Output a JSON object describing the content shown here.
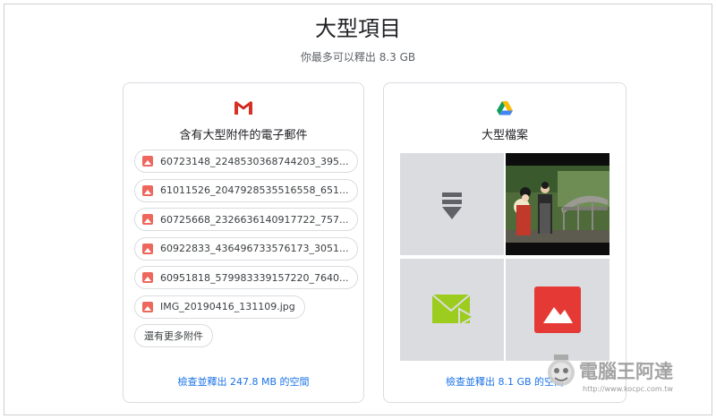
{
  "page": {
    "title": "大型項目",
    "subtitle": "你最多可以釋出 8.3 GB"
  },
  "gmail_card": {
    "icon": "gmail-icon",
    "title": "含有大型附件的電子郵件",
    "attachments": [
      "60723148_2248530368744203_395...",
      "61011526_2047928535516558_651...",
      "60725668_2326636140917722_757...",
      "60922833_436496733576173_3051...",
      "60951818_579983339157220_7640...",
      "IMG_20190416_131109.jpg"
    ],
    "more_label": "還有更多附件",
    "link_label": "檢查並釋出 247.8 MB 的空間"
  },
  "drive_card": {
    "icon": "google-drive-icon",
    "title": "大型檔案",
    "tiles": [
      "download-icon",
      "photo-thumbnail",
      "email-video-icon",
      "image-file-icon"
    ],
    "link_label": "檢查並釋出 8.1 GB 的空間"
  },
  "watermark": {
    "brand": "電腦王阿達",
    "url": "http://www.kocpc.com.tw"
  },
  "colors": {
    "link": "#1a73e8",
    "image_icon": "#ee675c",
    "tile_bg": "#dadce0",
    "drive_image_red": "#e53935",
    "email_video_green": "#9ccc1e"
  }
}
